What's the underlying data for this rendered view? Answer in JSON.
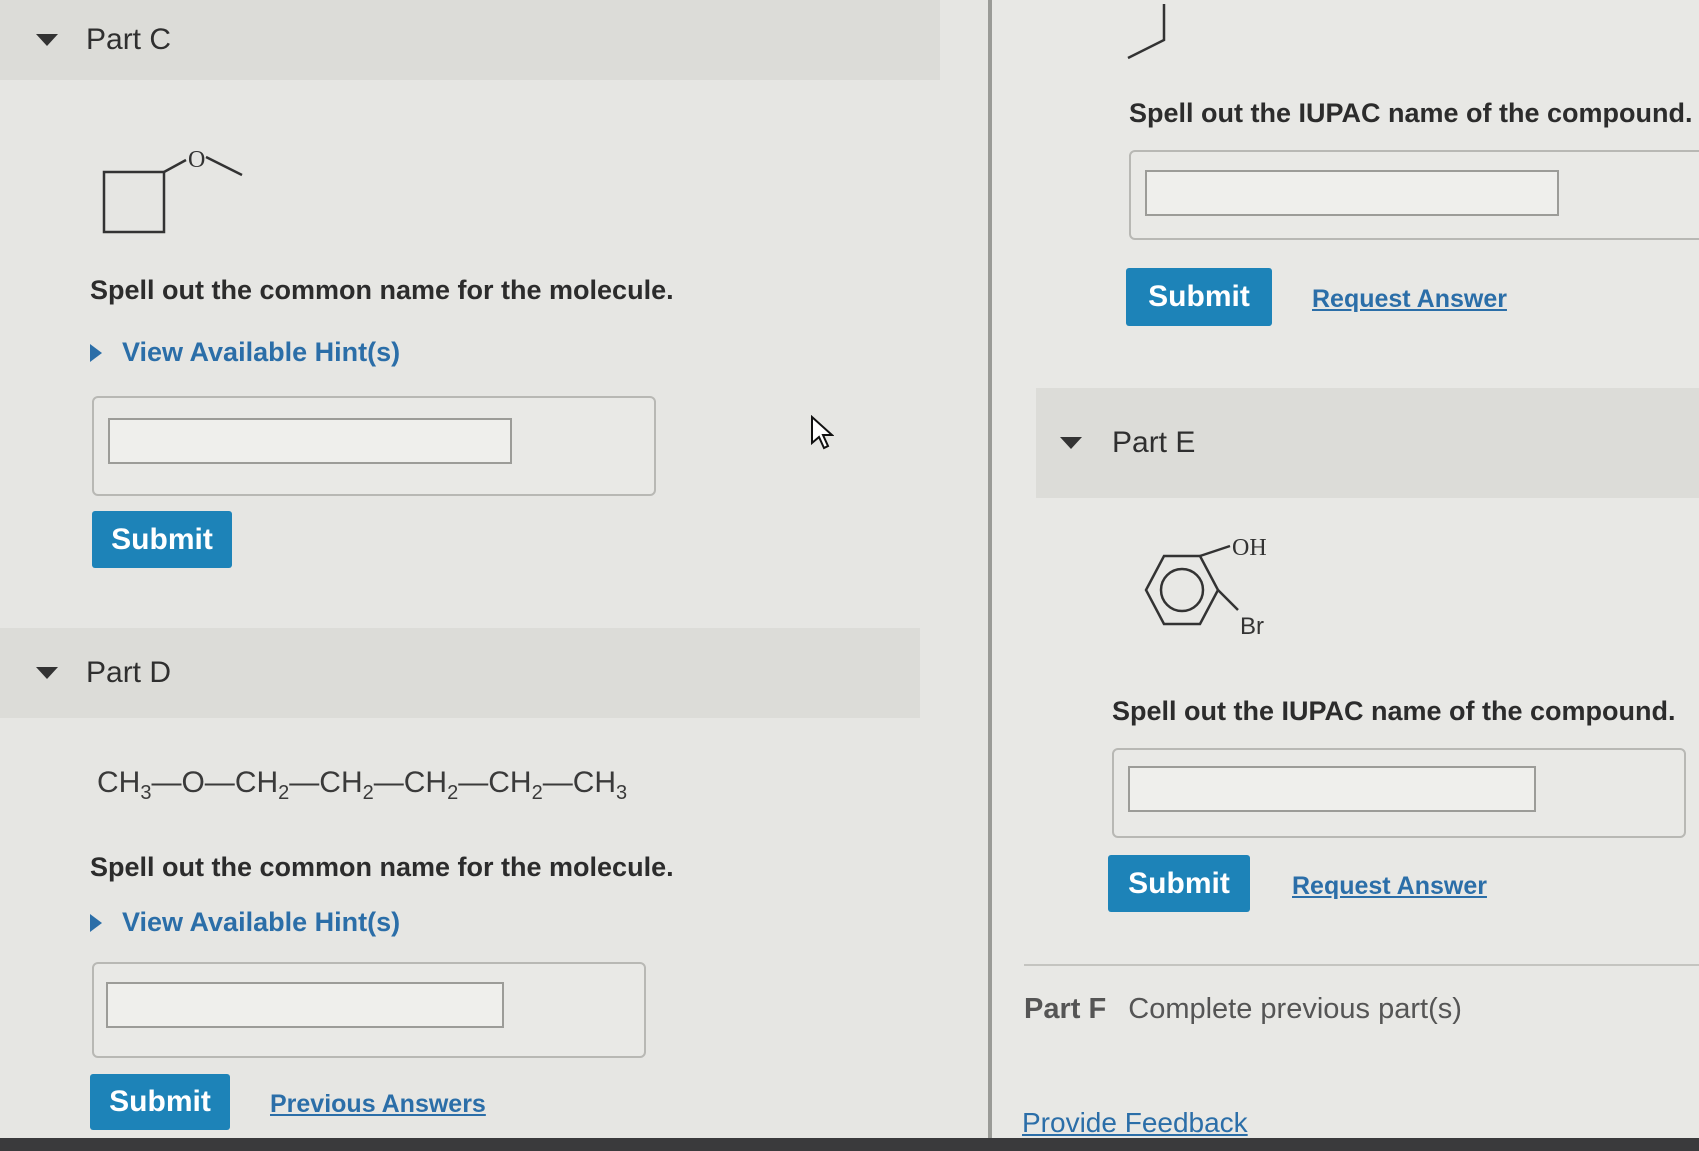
{
  "part_c": {
    "title": "Part C",
    "atom_label": "O",
    "prompt": "Spell out the common name for the molecule.",
    "hint": "View Available Hint(s)",
    "input_value": "",
    "submit": "Submit"
  },
  "part_d": {
    "title": "Part D",
    "formula": [
      "CH",
      "3",
      "—O—",
      "CH",
      "2",
      "—",
      "CH",
      "2",
      "—",
      "CH",
      "2",
      "—",
      "CH",
      "2",
      "—",
      "CH",
      "3"
    ],
    "prompt": "Spell out the common name for the molecule.",
    "hint": "View Available Hint(s)",
    "input_value": "",
    "submit": "Submit",
    "previous_answers": "Previous Answers"
  },
  "part_b_tail": {
    "prompt": "Spell out the IUPAC name of the compound.",
    "input_value": "",
    "submit": "Submit",
    "request_answer": "Request Answer"
  },
  "part_e": {
    "title": "Part E",
    "label_oh": "OH",
    "label_br": "Br",
    "prompt": "Spell out the IUPAC name of the compound.",
    "input_value": "",
    "submit": "Submit",
    "request_answer": "Request Answer"
  },
  "part_f": {
    "title": "Part F",
    "status": "Complete previous part(s)"
  },
  "feedback": "Provide Feedback"
}
